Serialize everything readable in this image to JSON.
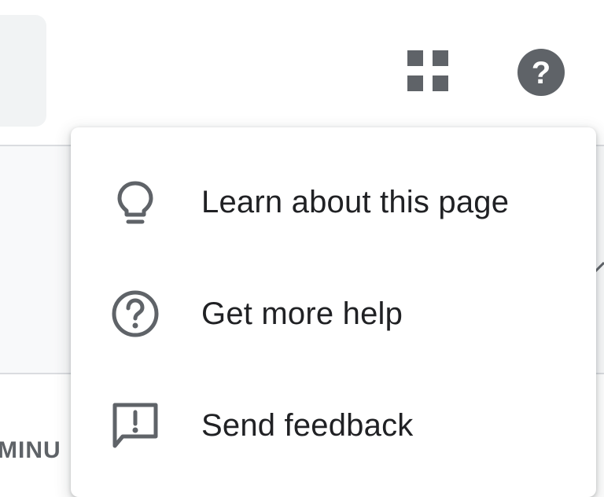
{
  "header": {
    "apps_icon": "apps-grid-icon",
    "help_icon": "help-circle-icon",
    "help_glyph": "?"
  },
  "background": {
    "partial_label": "MINU"
  },
  "help_menu": {
    "items": [
      {
        "label": "Learn about this page",
        "icon": "lightbulb-icon"
      },
      {
        "label": "Get more help",
        "icon": "help-outline-icon"
      },
      {
        "label": "Send feedback",
        "icon": "feedback-icon"
      }
    ]
  },
  "colors": {
    "icon_gray": "#5f6368",
    "text": "#202124",
    "surface": "#ffffff",
    "panel": "#f8f9fa",
    "divider": "#dadce0"
  }
}
